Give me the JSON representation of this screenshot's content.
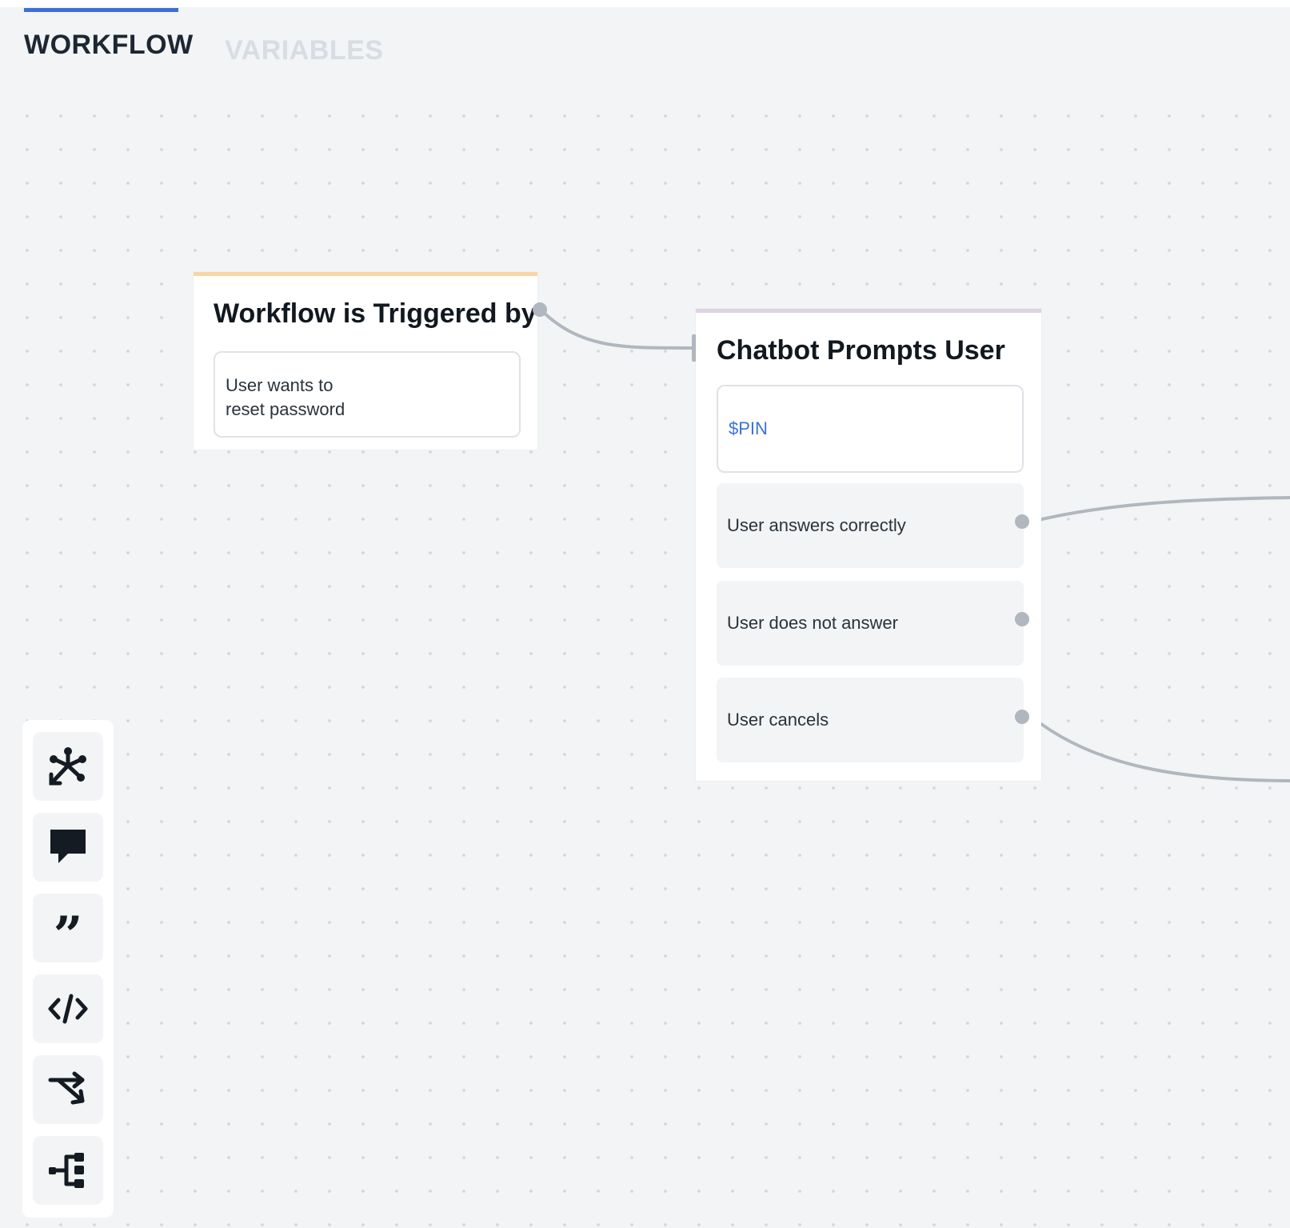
{
  "tabs": [
    {
      "label": "WORKFLOW",
      "active": true
    },
    {
      "label": "VARIABLES",
      "active": false
    }
  ],
  "nodes": {
    "trigger": {
      "title": "Workflow is Triggered by",
      "text_lines": [
        "User wants to",
        "reset password"
      ],
      "accent_color": "#f7d6a4"
    },
    "prompt": {
      "title": "Chatbot Prompts User",
      "variable": "$PIN",
      "options": [
        {
          "label": "User answers correctly"
        },
        {
          "label": "User does not answer"
        },
        {
          "label": "User cancels"
        }
      ],
      "accent_color": "#ddd3e3"
    }
  },
  "colors": {
    "accent": "#3d6fd4",
    "variable_text": "#3b73d6",
    "wire": "#b0b7be"
  },
  "toolbar": {
    "tools": [
      {
        "icon": "trigger-icon"
      },
      {
        "icon": "chat-bubble-icon"
      },
      {
        "icon": "quote-icon"
      },
      {
        "icon": "code-icon"
      },
      {
        "icon": "branch-icon"
      },
      {
        "icon": "subflow-icon"
      }
    ]
  }
}
